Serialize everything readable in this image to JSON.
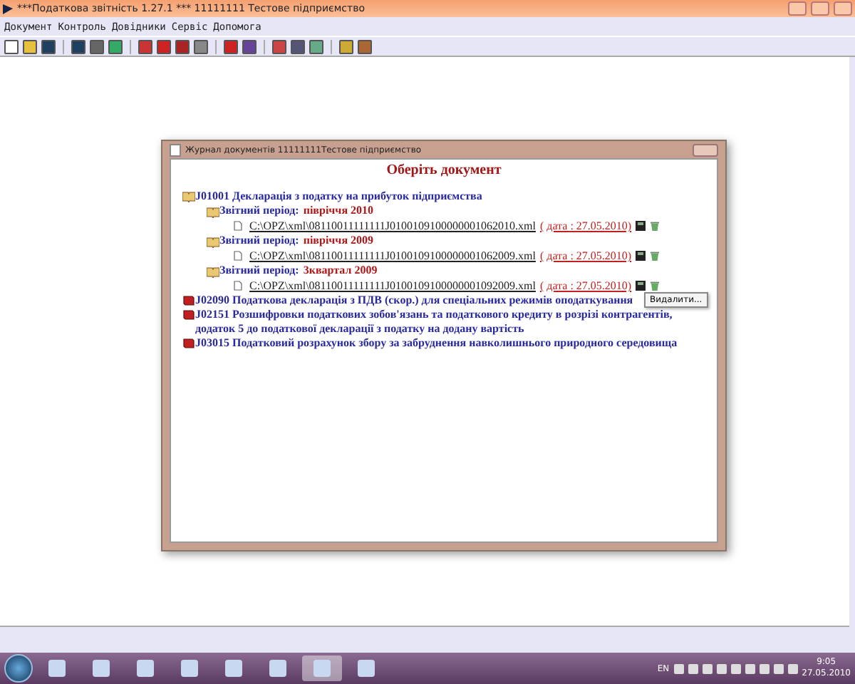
{
  "window": {
    "title": "***Податкова звітність 1.27.1 *** 11111111 Тестове підприємство"
  },
  "menu": [
    "Документ",
    "Контроль",
    "Довідники",
    "Сервіс",
    "Допомога"
  ],
  "dialog": {
    "title": "Журнал документів 11111111Тестове підприємство",
    "heading": "Оберіть документ",
    "documents": [
      {
        "code": "J01001",
        "name": "Декларація з податку на прибуток підприємства",
        "expanded": true,
        "periods": [
          {
            "label": "Звітний період:",
            "value": "півріччя 2010",
            "files": [
              {
                "path": "C:\\OPZ\\xml\\08110011111111J0100109100000001062010.xml",
                "date": "( дата : 27.05.2010)"
              }
            ]
          },
          {
            "label": "Звітний період:",
            "value": "півріччя 2009",
            "files": [
              {
                "path": "C:\\OPZ\\xml\\08110011111111J0100109100000001062009.xml",
                "date": "( дата : 27.05.2010)"
              }
            ]
          },
          {
            "label": "Звітний період:",
            "value": "3квартал 2009",
            "files": [
              {
                "path": "C:\\OPZ\\xml\\08110011111111J0100109100000001092009.xml",
                "date": "( дата : 27.05.2010)"
              }
            ]
          }
        ]
      },
      {
        "code": "J02090",
        "name": "Податкова декларація з ПДВ (скор.) для спеціальних режимів оподаткування",
        "expanded": false
      },
      {
        "code": "J02151",
        "name": "Розшифровки податкових зобов'язань та податкового кредиту в розрізі контрагентів, додаток 5 до податкової декларації з податку на додану вартість",
        "expanded": false
      },
      {
        "code": "J03015",
        "name": "Податковий розрахунок збору за забруднення навколишнього природного середовища",
        "expanded": false
      }
    ],
    "tooltip": "Видалити..."
  },
  "taskbar": {
    "apps": [
      {
        "selected": false
      },
      {
        "selected": false
      },
      {
        "selected": false
      },
      {
        "selected": false
      },
      {
        "selected": false
      },
      {
        "selected": false
      },
      {
        "selected": true
      },
      {
        "selected": false
      }
    ],
    "language": "EN",
    "time": "9:05",
    "date": "27.05.2010"
  }
}
